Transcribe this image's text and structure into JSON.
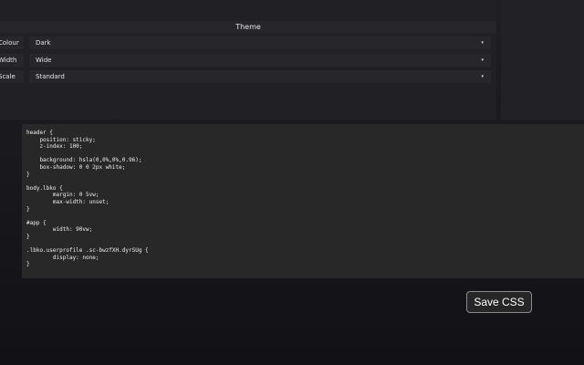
{
  "theme": {
    "heading": "Theme",
    "settings": [
      {
        "label": "Colour",
        "value": "Dark"
      },
      {
        "label": "Width",
        "value": "Wide"
      },
      {
        "label": "Scale",
        "value": "Standard"
      }
    ],
    "dropdown_icon": "▾"
  },
  "css_editor": {
    "content": "header {\n    position: sticky;\n    z-index: 100;\n\n    background: hsla(0,0%,0%,0.96);\n    box-shadow: 0 0 2px white;\n}\n\nbody.lbko {\n        margin: 0 5vw;\n        max-width: unset;\n}\n\n#app {\n        width: 90vw;\n}\n\n.lbko.userprofile .sc-bwzfXH.dyrSUg {\n        display: none;\n}"
  },
  "save_button": {
    "label": "Save CSS"
  }
}
